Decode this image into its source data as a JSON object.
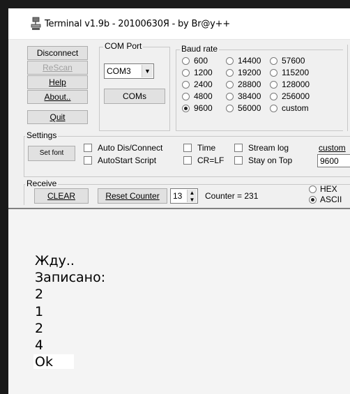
{
  "window": {
    "title": "Terminal v1.9b - 20100630Я - by Br@y++"
  },
  "buttons": {
    "disconnect": "Disconnect",
    "rescan": "ReScan",
    "help": "Help",
    "about": "About..",
    "quit": "Quit",
    "coms": "COMs",
    "set_font": "Set font",
    "clear": "CLEAR",
    "reset_counter": "Reset Counter"
  },
  "com_port": {
    "label": "COM Port",
    "value": "COM3"
  },
  "baud_rate": {
    "label": "Baud rate",
    "options": [
      "600",
      "1200",
      "2400",
      "4800",
      "9600",
      "14400",
      "19200",
      "28800",
      "38400",
      "56000",
      "57600",
      "115200",
      "128000",
      "256000",
      "custom"
    ],
    "selected": "9600"
  },
  "settings": {
    "label": "Settings",
    "checkboxes": [
      "Auto Dis/Connect",
      "AutoStart Script",
      "Time",
      "CR=LF",
      "Stream log",
      "Stay on Top"
    ],
    "custom_label": "custom",
    "custom_value": "9600"
  },
  "receive": {
    "label": "Receive",
    "counter_spin_value": "13",
    "counter_text": "Counter = 231",
    "format_options": [
      "HEX",
      "ASCII"
    ],
    "format_selected": "ASCII"
  },
  "output": {
    "lines": [
      "Жду..",
      "Записано:",
      "2",
      "1",
      "2",
      "4",
      "Ok"
    ]
  }
}
